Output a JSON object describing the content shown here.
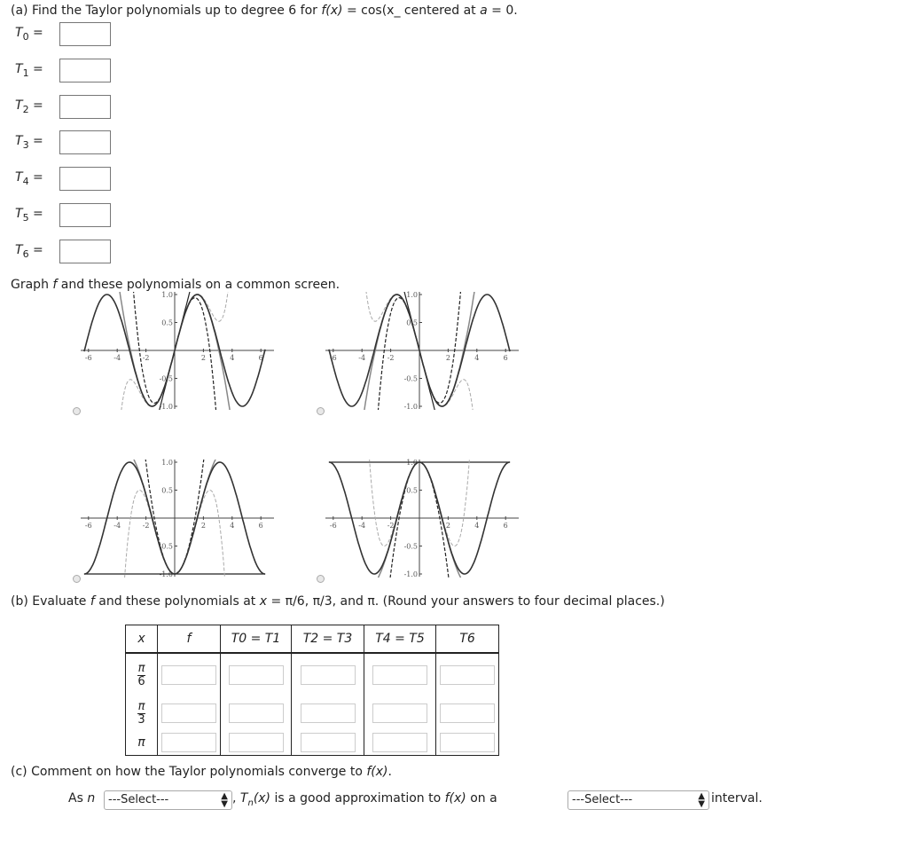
{
  "part_a": {
    "prefix": "(a) Find the Taylor polynomials up to degree 6 for ",
    "fx": "f(x)",
    "mid": " = cos(x_  centered at ",
    "a": "a",
    "end": " = 0."
  },
  "polys": [
    {
      "T": "T",
      "sub": "0",
      "eq": " ="
    },
    {
      "T": "T",
      "sub": "1",
      "eq": " ="
    },
    {
      "T": "T",
      "sub": "2",
      "eq": " ="
    },
    {
      "T": "T",
      "sub": "3",
      "eq": " ="
    },
    {
      "T": "T",
      "sub": "4",
      "eq": " ="
    },
    {
      "T": "T",
      "sub": "5",
      "eq": " ="
    },
    {
      "T": "T",
      "sub": "6",
      "eq": " ="
    }
  ],
  "graph_prompt": {
    "pre": "Graph ",
    "f": "f",
    "post": " and these polynomials on a common screen."
  },
  "graphs": {
    "x_ticks": [
      "-6",
      "-4",
      "-2",
      "2",
      "4",
      "6"
    ],
    "y_ticks": [
      "1.0",
      "0.5",
      "-0.5",
      "-1.0"
    ],
    "options": [
      {
        "function": "sin"
      },
      {
        "function": "-sin"
      },
      {
        "function": "-cos"
      },
      {
        "function": "cos"
      }
    ],
    "colors": {
      "f": "#333333",
      "poly": "#888888",
      "dashed_dark": "#222222",
      "dashed_light": "#aaaaaa"
    }
  },
  "part_b": {
    "pre": "(b) Evaluate ",
    "f": "f",
    "mid": " and these polynomials at ",
    "x": "x",
    "vals": " = π/6, π/3, and π. (Round your answers to four decimal places.)"
  },
  "table": {
    "headers": [
      "x",
      "f",
      "T0 = T1",
      "T2 = T3",
      "T4 = T5",
      "T6"
    ],
    "rows": [
      {
        "num": "π",
        "den": "6"
      },
      {
        "num": "π",
        "den": "3"
      },
      {
        "x": "π"
      }
    ]
  },
  "part_c": {
    "text": "(c) Comment on how the Taylor polynomials converge to ",
    "fx": "f(x)",
    "end": "."
  },
  "sentence": {
    "as": "As ",
    "n": "n",
    "select1": "---Select---",
    "comma": " , ",
    "tn": "T",
    "tn_sub": "n",
    "tn_x": "(x)",
    "mid": "  is a good approximation to  ",
    "fx": "f(x)",
    "on": "  on a ",
    "select2": "---Select---",
    "end": " interval."
  }
}
